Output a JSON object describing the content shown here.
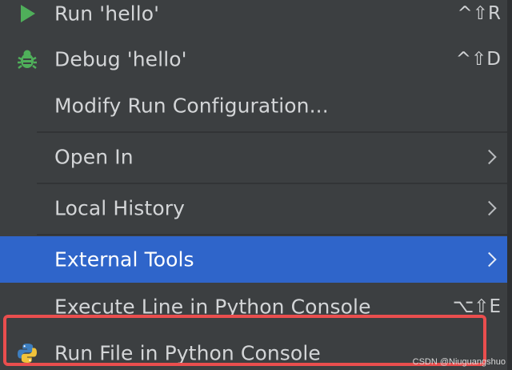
{
  "menu": {
    "items": [
      {
        "label": "Run 'hello'",
        "shortcut": "^⇧R",
        "icon": "run-triangle-icon"
      },
      {
        "label": "Debug 'hello'",
        "shortcut": "^⇧D",
        "icon": "debug-bug-icon"
      },
      {
        "label": "Modify Run Configuration...",
        "shortcut": ""
      },
      {
        "label": "Open In",
        "submenu": true
      },
      {
        "label": "Local History",
        "submenu": true
      },
      {
        "label": "External Tools",
        "submenu": true,
        "selected": true
      },
      {
        "label": "Execute Line in Python Console",
        "shortcut": "⌥⇧E"
      },
      {
        "label": "Run File in Python Console",
        "icon": "python-logo-icon",
        "highlighted": true
      }
    ]
  },
  "colors": {
    "background": "#3c3f41",
    "selection": "#2f65ca",
    "run_icon": "#4faf5a",
    "debug_icon": "#4faf5a",
    "highlight_border": "#ea4e4e"
  },
  "watermark": "CSDN @Niuguangshuo"
}
